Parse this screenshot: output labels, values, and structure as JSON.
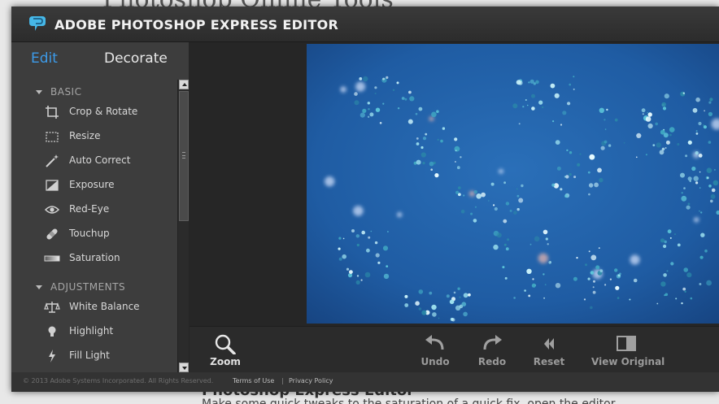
{
  "background_page": {
    "heading": "Photoshop Online Tools",
    "subheading": "Photoshop Express Editor",
    "body_text": "Make some quick tweaks to the saturation of a quick fix, open the editor"
  },
  "app": {
    "title": "ADOBE PHOTOSHOP EXPRESS EDITOR",
    "logo_icon": "photoshop-express-logo",
    "accent_color": "#3d9be9"
  },
  "left_panel": {
    "tabs": [
      {
        "label": "Edit",
        "active": true
      },
      {
        "label": "Decorate",
        "active": false
      }
    ],
    "sections": [
      {
        "label": "BASIC",
        "tools": [
          {
            "label": "Crop & Rotate",
            "icon": "crop-icon"
          },
          {
            "label": "Resize",
            "icon": "resize-icon"
          },
          {
            "label": "Auto Correct",
            "icon": "magic-wand-icon"
          },
          {
            "label": "Exposure",
            "icon": "exposure-icon"
          },
          {
            "label": "Red-Eye",
            "icon": "eye-icon"
          },
          {
            "label": "Touchup",
            "icon": "bandage-icon"
          },
          {
            "label": "Saturation",
            "icon": "saturation-icon"
          }
        ]
      },
      {
        "label": "ADJUSTMENTS",
        "tools": [
          {
            "label": "White Balance",
            "icon": "scales-icon"
          },
          {
            "label": "Highlight",
            "icon": "lightbulb-icon"
          },
          {
            "label": "Fill Light",
            "icon": "lightning-icon"
          }
        ]
      }
    ]
  },
  "toolbar": {
    "zoom": {
      "label": "Zoom",
      "icon": "magnifier-icon"
    },
    "undo": {
      "label": "Undo",
      "icon": "undo-icon"
    },
    "redo": {
      "label": "Redo",
      "icon": "redo-icon"
    },
    "reset": {
      "label": "Reset",
      "icon": "rewind-icon"
    },
    "view_original": {
      "label": "View Original",
      "icon": "compare-icon"
    }
  },
  "footer": {
    "copyright": "© 2013 Adobe Systems Incorporated. All Rights Reserved.",
    "terms": "Terms of Use",
    "separator": "|",
    "privacy": "Privacy Policy"
  }
}
